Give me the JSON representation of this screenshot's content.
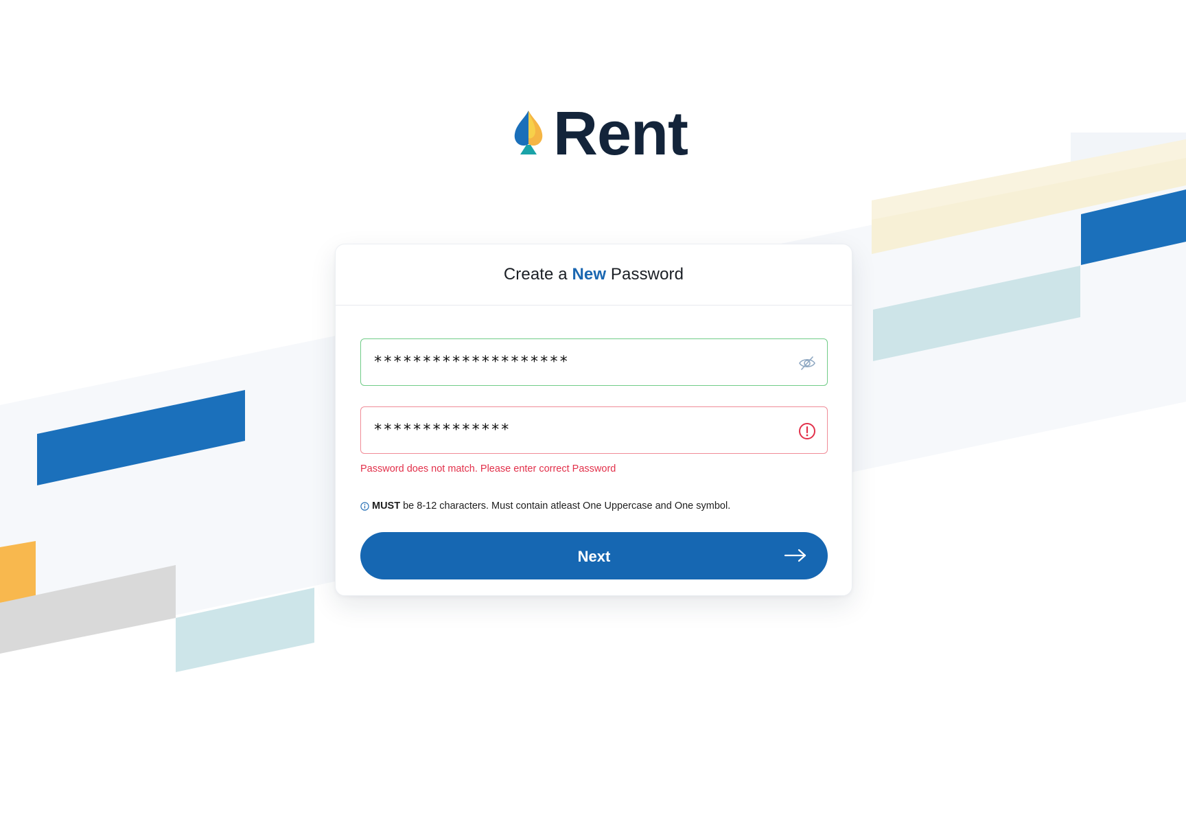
{
  "brand": {
    "name": "Rent"
  },
  "card": {
    "title_prefix": "Create a ",
    "title_accent": "New",
    "title_suffix": " Password"
  },
  "fields": {
    "new_password": {
      "value": "********************",
      "state": "valid",
      "icon": "eye-slash-icon"
    },
    "confirm_password": {
      "value": "**************",
      "state": "invalid",
      "icon": "alert-circle-icon"
    }
  },
  "error_message": "Password does not match. Please enter correct Password",
  "hint": {
    "strong": "MUST",
    "text": "be 8-12 characters. Must contain atleast One Uppercase and One symbol.",
    "icon": "info-icon"
  },
  "next_button": {
    "label": "Next",
    "icon": "arrow-right-icon"
  },
  "colors": {
    "primary": "#1667b2",
    "success_border": "#6fcb86",
    "error": "#e2304a",
    "brand_text": "#13243a",
    "accent_yellow": "#f8b84e",
    "accent_teal": "#cde5e9"
  }
}
